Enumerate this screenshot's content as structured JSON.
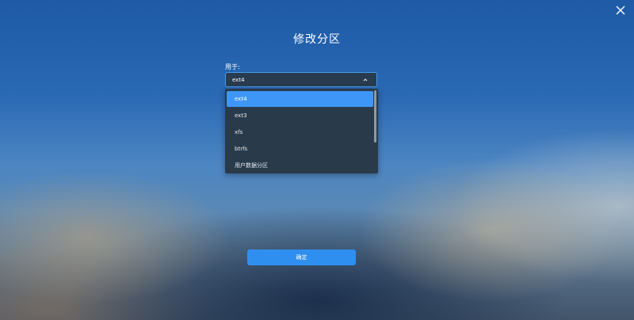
{
  "dialog": {
    "title": "修改分区",
    "field_label": "用于:",
    "selected_value": "ext4",
    "options": [
      "ext4",
      "ext3",
      "xfs",
      "btrfs",
      "用户数据分区"
    ],
    "confirm_label": "确定"
  },
  "icons": {
    "close": "close-icon",
    "chevron": "chevron-up-icon"
  },
  "colors": {
    "accent": "#2f8ff0",
    "selected_option": "#3e97f6",
    "dropdown_bg": "#293a4a"
  }
}
